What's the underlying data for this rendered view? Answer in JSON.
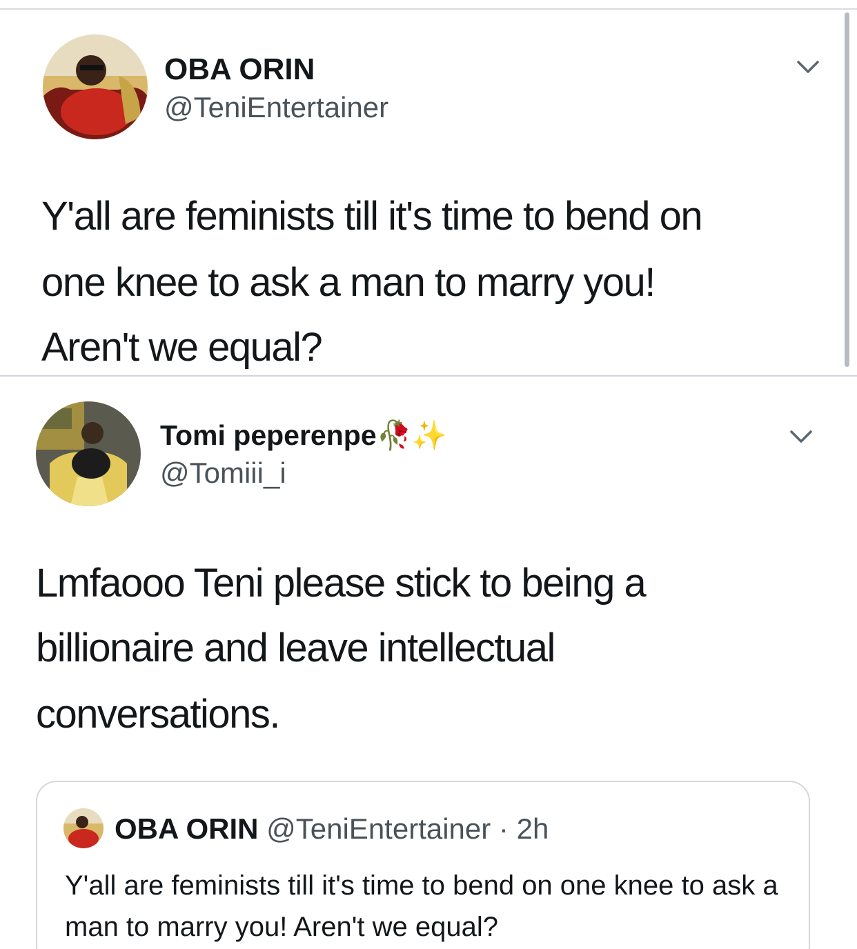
{
  "tweet1": {
    "display_name": "OBA ORIN",
    "handle": "@TeniEntertainer",
    "text_line1": "Y'all are feminists till it's time to bend on",
    "text_line2": "one knee to ask a man to marry you!",
    "text_line3": "Aren't we equal?"
  },
  "tweet2": {
    "display_name": "Tomi peperenpe",
    "name_emoji": "🥀✨",
    "handle": "@Tomiii_i",
    "text_line1": "Lmfaooo Teni please stick to being a",
    "text_line2": "billionaire and leave intellectual",
    "text_line3": "conversations."
  },
  "quoted_tweet": {
    "display_name": "OBA ORIN",
    "handle": "@TeniEntertainer",
    "separator": " · ",
    "time": "2h",
    "text": "Y'all are feminists till it's time to bend on one knee to ask a man to marry you! Aren't we equal?"
  },
  "icons": {
    "more_menu": "chevron-down-icon"
  },
  "colors": {
    "text_primary": "#14171a",
    "text_secondary": "#4a5259",
    "divider": "#d8dde2"
  }
}
